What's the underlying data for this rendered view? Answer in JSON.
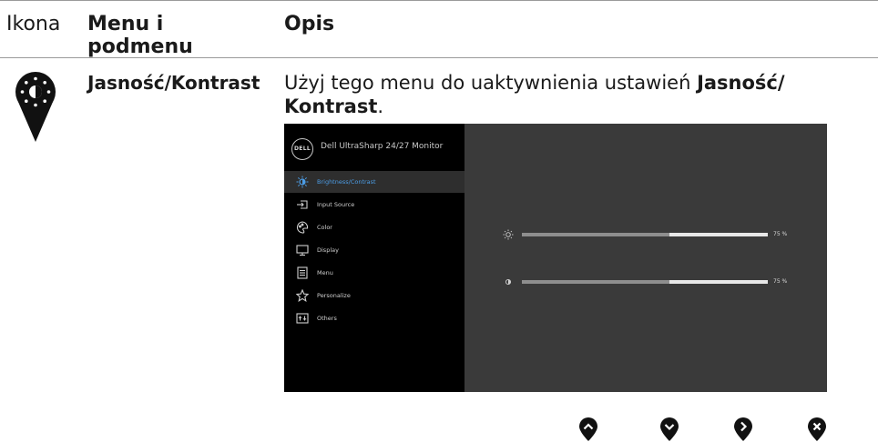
{
  "header": {
    "col_icon": "Ikona",
    "col_menu": "Menu i podmenu",
    "col_desc": "Opis"
  },
  "row": {
    "icon_name": "brightness-contrast-pin-icon",
    "menu_name": "Jasność/Kontrast",
    "desc_prefix": "Użyj tego menu do uaktywnienia ustawień ",
    "desc_bold": "Jasność/ Kontrast",
    "desc_suffix": "."
  },
  "osd": {
    "logo_text": "DELL",
    "title": "Dell UltraSharp 24/27 Monitor",
    "accent_color": "#4c9de6",
    "menu_items": [
      {
        "label": "Brightness/Contrast",
        "icon": "brightness-icon",
        "selected": true
      },
      {
        "label": "Input Source",
        "icon": "input-source-icon",
        "selected": false
      },
      {
        "label": "Color",
        "icon": "color-palette-icon",
        "selected": false
      },
      {
        "label": "Display",
        "icon": "display-monitor-icon",
        "selected": false
      },
      {
        "label": "Menu",
        "icon": "menu-list-icon",
        "selected": false
      },
      {
        "label": "Personalize",
        "icon": "star-icon",
        "selected": false
      },
      {
        "label": "Others",
        "icon": "others-icon",
        "selected": false
      }
    ],
    "sliders": [
      {
        "name": "brightness",
        "icon": "sun-icon",
        "value": 75,
        "display": "75 %"
      },
      {
        "name": "contrast",
        "icon": "contrast-icon",
        "value": 75,
        "display": "75 %"
      }
    ]
  },
  "nav_buttons": [
    {
      "name": "up-button-icon",
      "glyph": "up"
    },
    {
      "name": "down-button-icon",
      "glyph": "down"
    },
    {
      "name": "right-button-icon",
      "glyph": "right"
    },
    {
      "name": "close-button-icon",
      "glyph": "close"
    }
  ]
}
